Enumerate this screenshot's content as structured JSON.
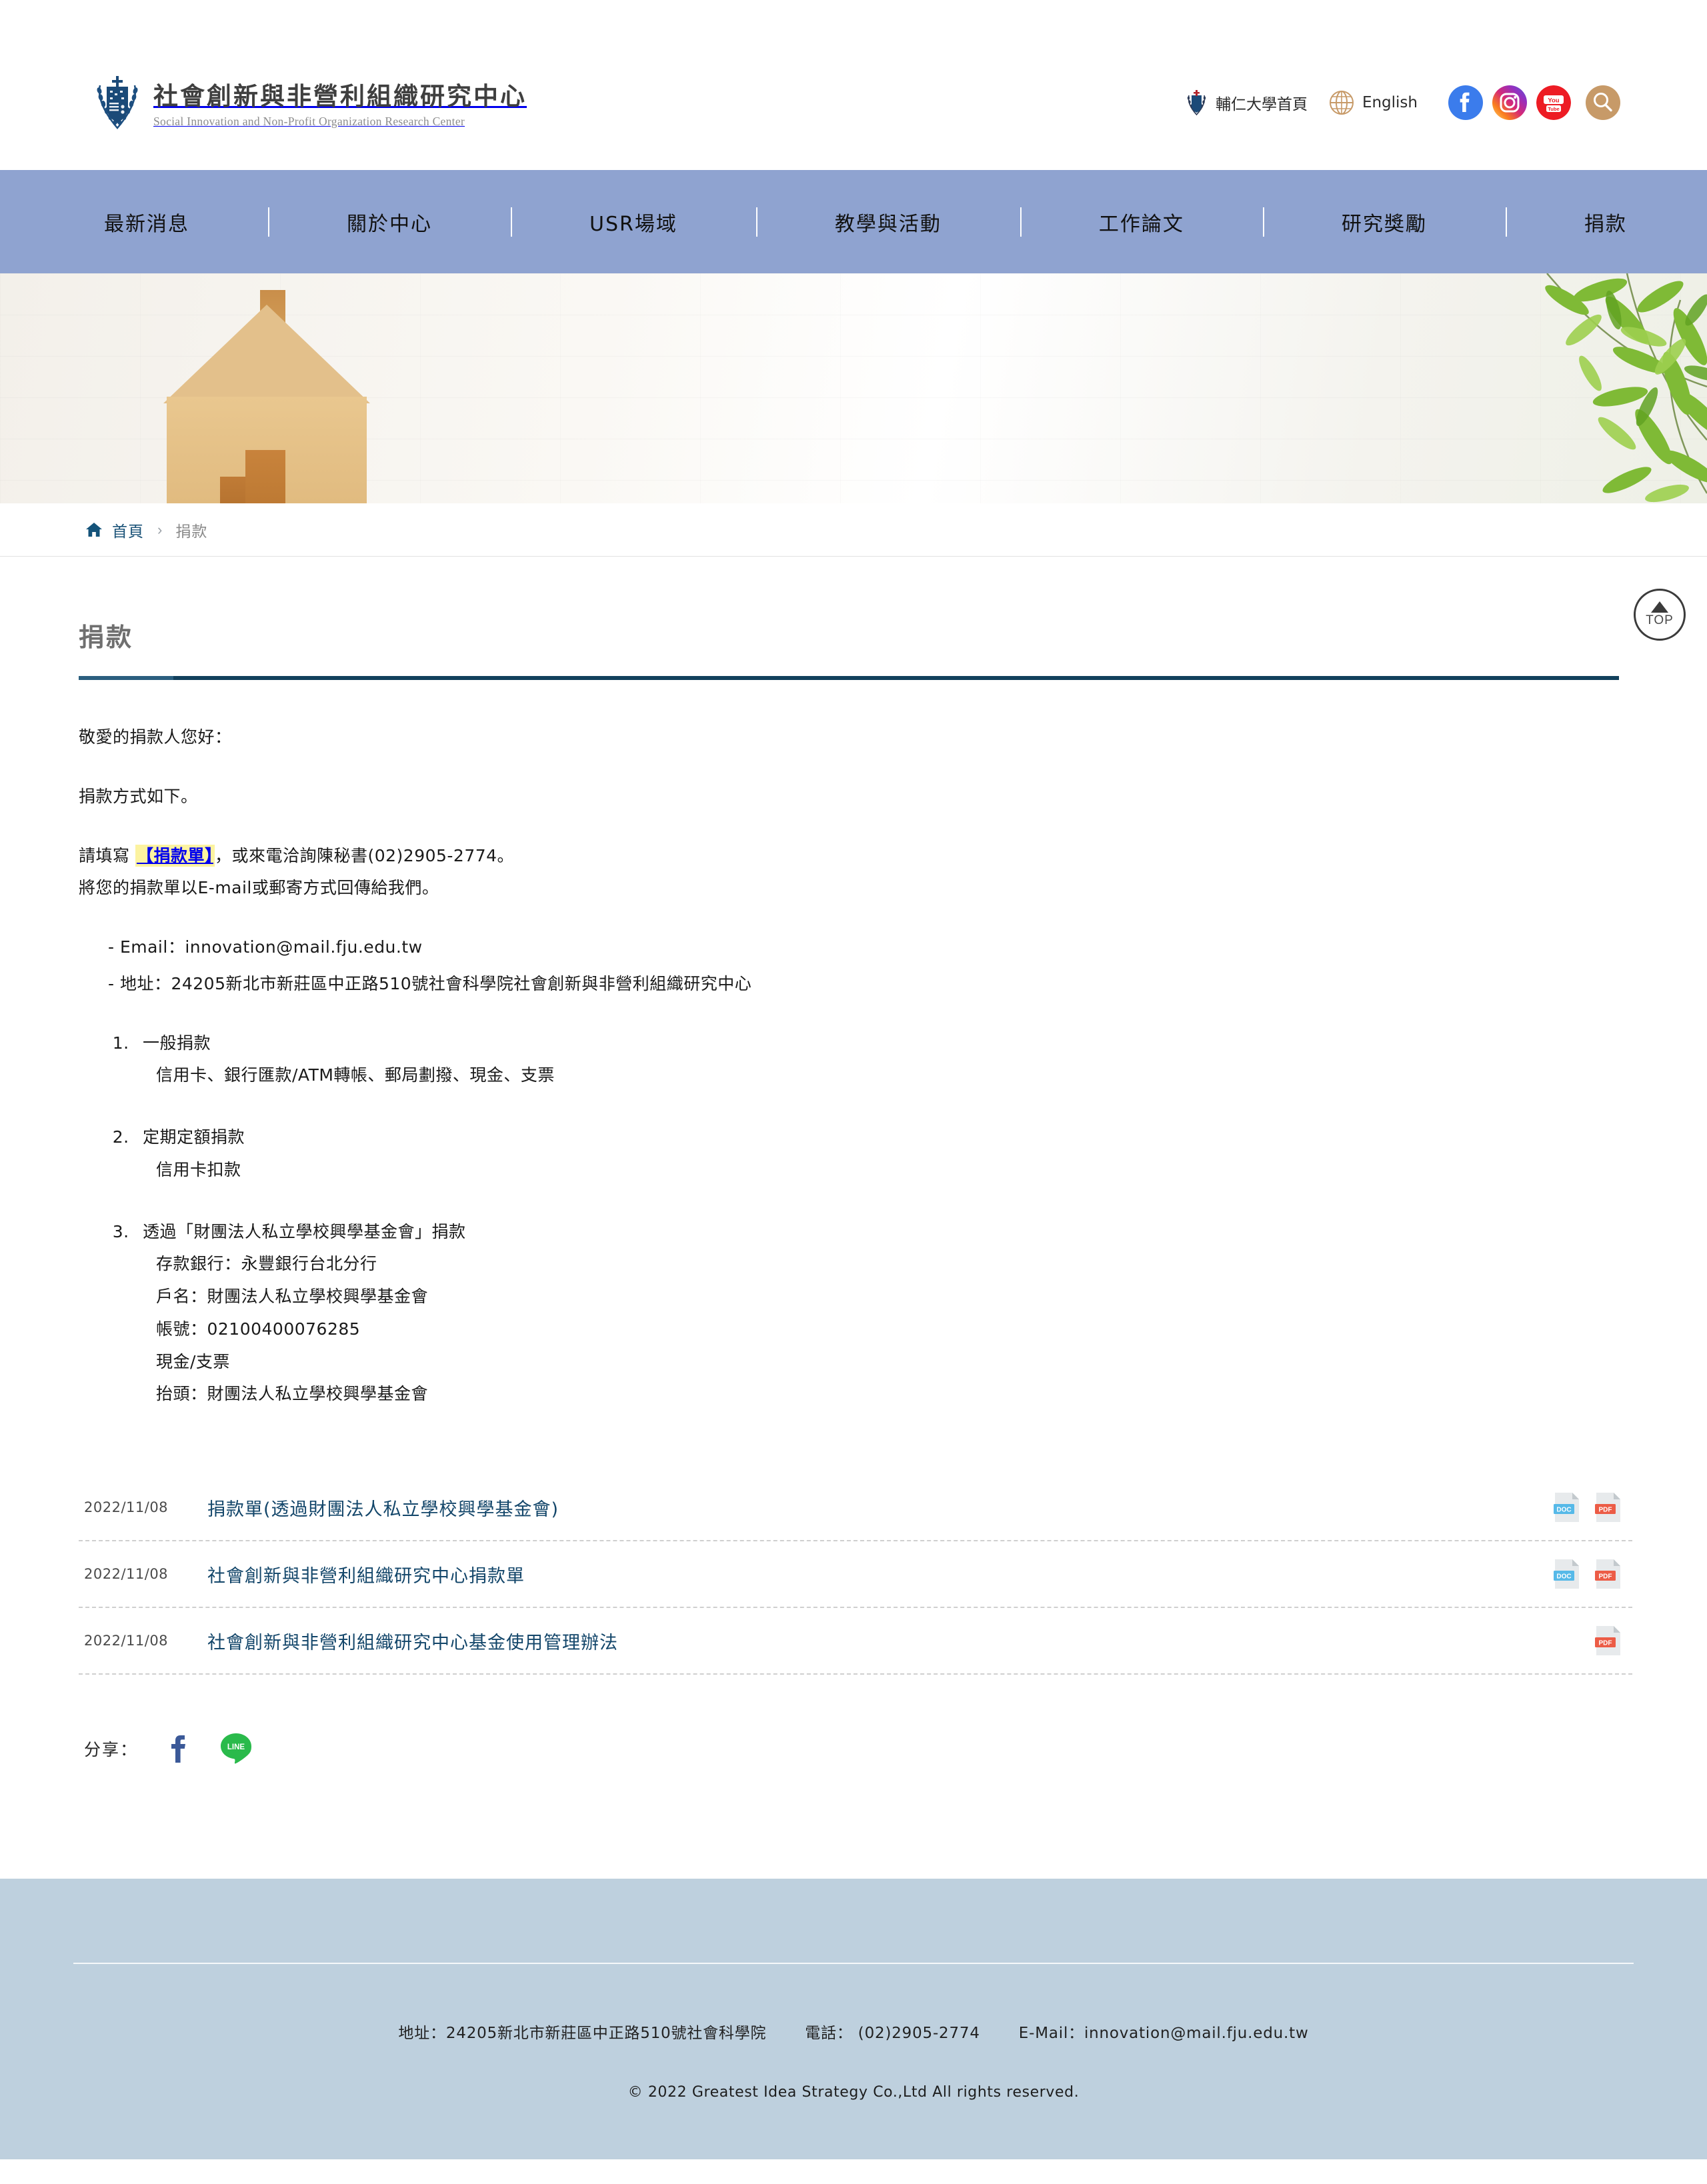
{
  "site": {
    "logo_cn": "社會創新與非營利組織研究中心",
    "logo_en": "Social Innovation and Non-Profit Organization Research Center",
    "logo_icon": "fju-crest-icon"
  },
  "header": {
    "university_link": "輔仁大學首頁",
    "language_link": "English",
    "social": [
      {
        "name": "facebook-icon",
        "label": "Facebook"
      },
      {
        "name": "instagram-icon",
        "label": "Instagram"
      },
      {
        "name": "youtube-icon",
        "label": "YouTube"
      }
    ],
    "search_icon": "search-icon",
    "globe_icon": "globe-icon"
  },
  "nav": {
    "items": [
      {
        "label": "最新消息"
      },
      {
        "label": "關於中心"
      },
      {
        "label": "USR場域"
      },
      {
        "label": "教學與活動"
      },
      {
        "label": "工作論文"
      },
      {
        "label": "研究獎勵"
      },
      {
        "label": "捐款"
      }
    ]
  },
  "breadcrumb": {
    "home_icon": "home-icon",
    "home": "首頁",
    "separator": "›",
    "current": "捐款"
  },
  "page": {
    "title": "捐款",
    "greeting": "敬愛的捐款人您好：",
    "intro": "捐款方式如下。",
    "form_line_pre": "請填寫 ",
    "form_link": "【捐款單】",
    "form_line_post": "，或來電洽詢陳秘書(02)2905-2774。",
    "form_line2": "將您的捐款單以E-mail或郵寄方式回傳給我們。",
    "contacts": [
      "- Email：innovation@mail.fju.edu.tw",
      "- 地址：24205新北市新莊區中正路510號社會科學院社會創新與非營利組織研究中心"
    ],
    "methods": [
      {
        "title": "一般捐款",
        "lines": [
          "信用卡、銀行匯款/ATM轉帳、郵局劃撥、現金、支票"
        ]
      },
      {
        "title": "定期定額捐款",
        "lines": [
          "信用卡扣款"
        ]
      },
      {
        "title": "透過「財團法人私立學校興學基金會」捐款",
        "lines": [
          "存款銀行：永豐銀行台北分行",
          "戶名：財團法人私立學校興學基金會",
          "帳號：02100400076285"
        ],
        "extra_lines": [
          "現金/支票",
          "抬頭：財團法人私立學校興學基金會"
        ]
      }
    ]
  },
  "files": [
    {
      "date": "2022/11/08",
      "name": "捐款單(透過財團法人私立學校興學基金會)",
      "types": [
        "DOC",
        "PDF"
      ]
    },
    {
      "date": "2022/11/08",
      "name": "社會創新與非營利組織研究中心捐款單",
      "types": [
        "DOC",
        "PDF"
      ]
    },
    {
      "date": "2022/11/08",
      "name": "社會創新與非營利組織研究中心基金使用管理辦法",
      "types": [
        "PDF"
      ]
    }
  ],
  "share": {
    "label": "分享：",
    "facebook_icon": "facebook-share-icon",
    "line_icon": "line-share-icon",
    "line_text": "LINE"
  },
  "top_button": {
    "label": "TOP",
    "icon": "triangle-up-icon"
  },
  "footer": {
    "address": "地址：24205新北市新莊區中正路510號社會科學院",
    "phone": "電話： (02)2905-2774",
    "email": "E-Mail：innovation@mail.fju.edu.tw",
    "copyright": "© 2022 Greatest Idea Strategy Co.,Ltd All rights reserved."
  },
  "colors": {
    "nav_bg": "#8fa3d0",
    "footer_bg": "#bed0de",
    "accent_dark": "#12405c",
    "link_blue": "#13466a",
    "highlight_yellow": "#fcf3a0",
    "search_btn": "#c79a68"
  }
}
